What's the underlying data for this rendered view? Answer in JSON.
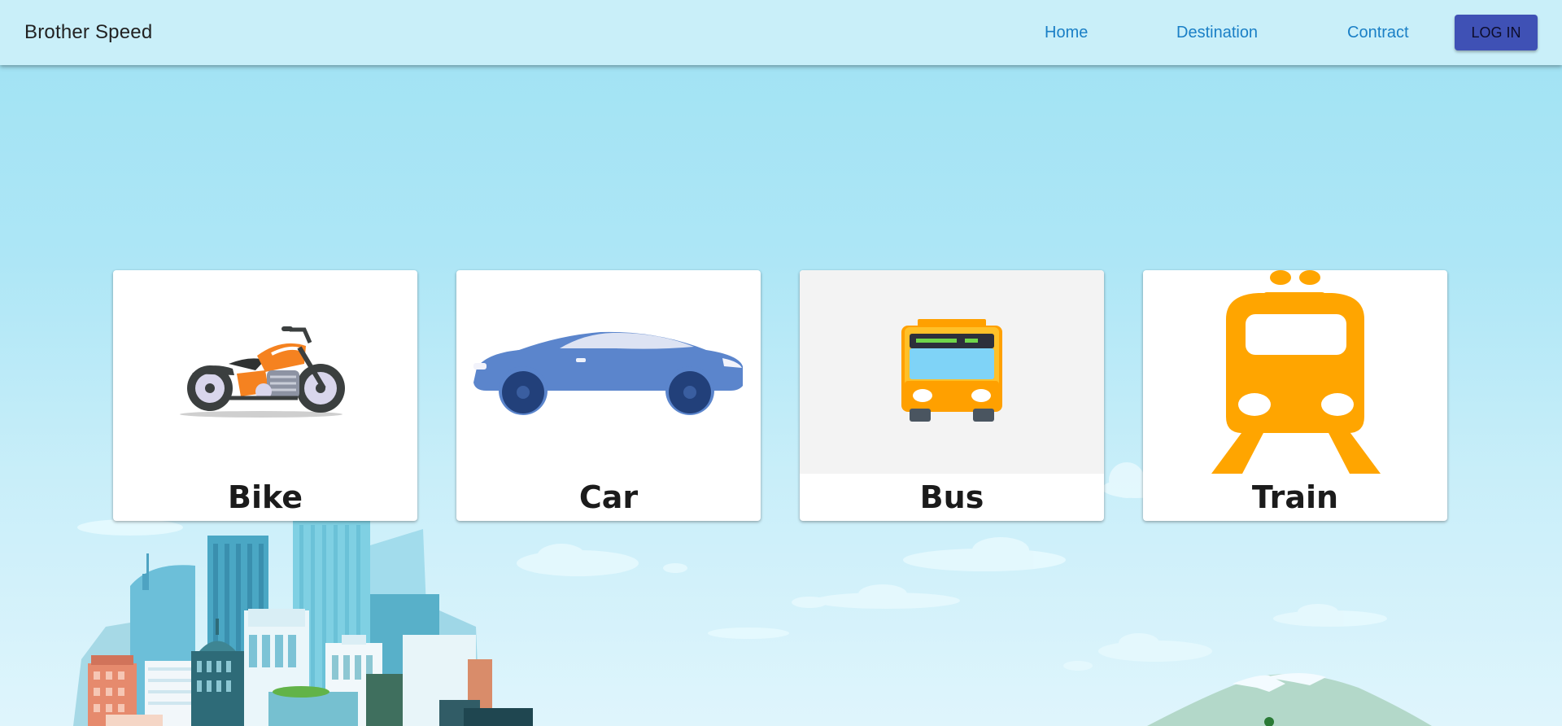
{
  "appbar": {
    "brand": "Brother Speed",
    "nav": [
      "Home",
      "Destination",
      "Contract"
    ],
    "login_label": "LOG IN"
  },
  "cards": [
    {
      "title": "Bike",
      "icon": "motorcycle-icon"
    },
    {
      "title": "Car",
      "icon": "car-icon"
    },
    {
      "title": "Bus",
      "icon": "bus-icon"
    },
    {
      "title": "Train",
      "icon": "train-icon"
    }
  ],
  "colors": {
    "appbar_bg": "#c9eff9",
    "nav_link": "#1a7fc6",
    "login_button": "#3f51b5",
    "sky": "#a6e4f5",
    "train": "#ffa500",
    "bus": "#ffa000",
    "car": "#5b85cc"
  }
}
